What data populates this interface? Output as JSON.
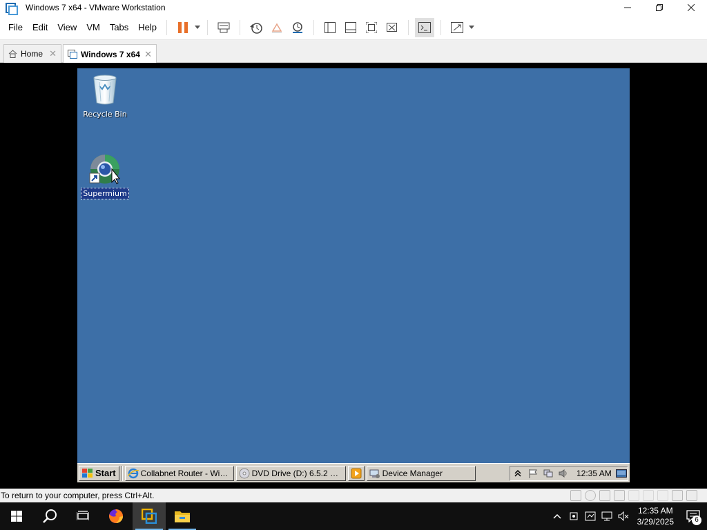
{
  "window": {
    "title": "Windows 7 x64 - VMware Workstation",
    "controls": [
      "minimize-icon",
      "restore-icon",
      "close-icon"
    ]
  },
  "menu": [
    "File",
    "Edit",
    "View",
    "VM",
    "Tabs",
    "Help"
  ],
  "toolbar": {
    "icons": [
      "pause-icon",
      "send-ctrl-alt-del-icon",
      "snapshot-icon",
      "revert-snapshot-icon",
      "snapshot-manager-icon",
      "show-library-icon",
      "thumbnail-bar-icon",
      "full-screen-icon",
      "unity-icon",
      "console-view-icon",
      "stretch-guest-icon"
    ]
  },
  "tabs": [
    {
      "label": "Home",
      "icon": "home-icon",
      "active": false
    },
    {
      "label": "Windows 7 x64",
      "icon": "vm-icon",
      "active": true
    }
  ],
  "guest": {
    "desktop_color": "#3d6fa7",
    "desktop_icons": [
      {
        "label": "Recycle Bin",
        "icon": "recycle-bin-icon",
        "selected": false
      },
      {
        "label": "Supermium",
        "icon": "supermium-icon",
        "selected": true
      }
    ],
    "taskbar": {
      "start_label": "Start",
      "tasks": [
        {
          "label": "Collabnet Router - Wind...",
          "icon": "ie-icon"
        },
        {
          "label": "DVD Drive (D:) 6.5.2 driv...",
          "icon": "dvd-icon"
        },
        {
          "label": "",
          "icon": "media-icon"
        },
        {
          "label": "Device Manager",
          "icon": "device-manager-icon"
        }
      ],
      "tray_icons": [
        "show-hidden-icon",
        "action-center-flag-icon",
        "network-icon",
        "volume-icon"
      ],
      "clock": "12:35 AM"
    }
  },
  "statusbar": {
    "message": "To return to your computer, press Ctrl+Alt.",
    "device_icons": [
      "hard-disk-icon",
      "cd-dvd-icon",
      "network-adapter-icon",
      "usb-icon",
      "sound-card-icon",
      "printer-icon",
      "display-icon",
      "message-log-icon",
      "vm-settings-icon"
    ]
  },
  "host": {
    "taskbar_icons": [
      "windows-start-icon",
      "search-icon",
      "task-view-icon",
      "firefox-icon",
      "vmware-icon",
      "file-explorer-icon"
    ],
    "tray_icons": [
      "tray-chevron-icon",
      "tray-app-icon",
      "tray-security-icon",
      "tray-network-icon",
      "tray-volume-muted-icon"
    ],
    "time": "12:35 AM",
    "date": "3/29/2025",
    "notifications": "6"
  }
}
